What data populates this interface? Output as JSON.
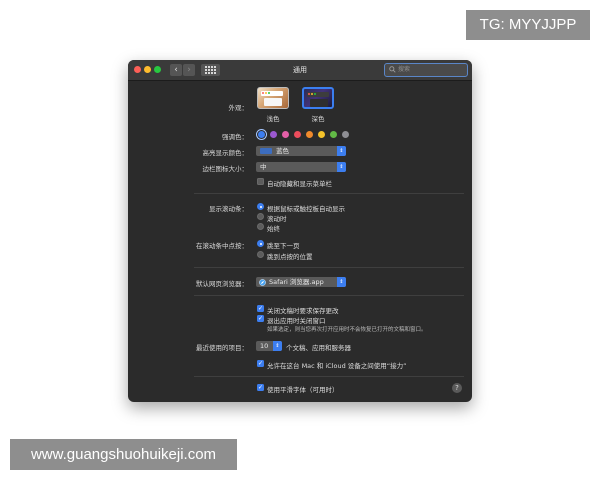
{
  "badges": {
    "telegram": "TG: MYYJJPP",
    "website": "www.guangshuohuikeji.com"
  },
  "window": {
    "title": "通用",
    "search_placeholder": "搜索"
  },
  "icons": {
    "back": "‹",
    "forward": "›",
    "help": "?",
    "check": "✓",
    "popup_arrows": "⇕"
  },
  "appearance": {
    "label": "外观：",
    "options": [
      "浅色",
      "深色"
    ],
    "selected": "深色"
  },
  "accent": {
    "label": "强调色：",
    "colors": [
      "#3c7ef0",
      "#9b59d0",
      "#e35fa7",
      "#ec4d5c",
      "#f08a2c",
      "#f5c32a",
      "#62ba46",
      "#8e8e93"
    ],
    "selected_index": 0
  },
  "highlight": {
    "label": "高亮显示颜色：",
    "value": "蓝色",
    "swatch_color": "#3c6dbf"
  },
  "sidebar_icon": {
    "label": "边栏图标大小：",
    "value": "中"
  },
  "auto_hide_menu": {
    "label": "自动隐藏和显示菜单栏",
    "checked": false
  },
  "scroll_bars": {
    "label": "显示滚动条：",
    "options": [
      "根据鼠标或触控板自动显示",
      "滚动时",
      "始终"
    ],
    "selected_index": 0
  },
  "click_scroll": {
    "label": "在滚动条中点按：",
    "options": [
      "跳至下一页",
      "跳到点按的位置"
    ],
    "selected_index": 0
  },
  "default_browser": {
    "label": "默认网页浏览器：",
    "value": "Safari 浏览器.app"
  },
  "documents": {
    "ask_keep_changes": "关闭文稿时要求保存更改",
    "close_windows": "退出应用时关闭窗口",
    "note": "如果选定，则当您再次打开应用时不会恢复已打开的文稿和窗口。"
  },
  "recent_items": {
    "label": "最近使用的项目：",
    "value": "10",
    "suffix": "个文稿、应用和服务器"
  },
  "handoff": {
    "label": "允许在这台 Mac 和 iCloud 设备之间使用“接力”",
    "checked": true
  },
  "font_smoothing": {
    "label": "使用平滑字体（可用时）",
    "checked": true
  }
}
